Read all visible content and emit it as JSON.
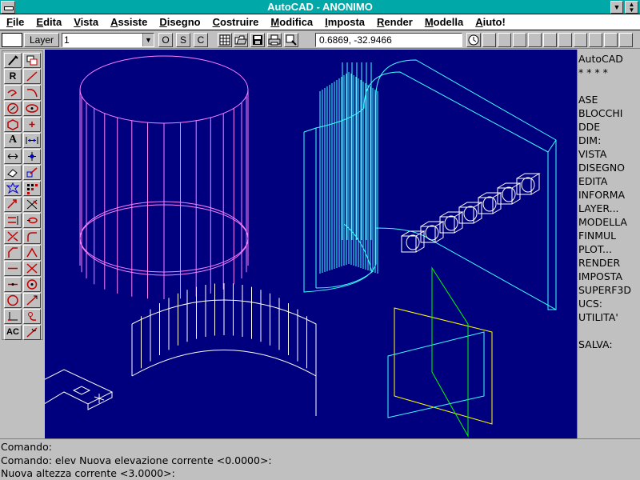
{
  "window": {
    "title": "AutoCAD - ANONIMO",
    "scroll_arrow": "▼"
  },
  "menubar": {
    "items": [
      "File",
      "Edita",
      "Vista",
      "Assiste",
      "Disegno",
      "Costruire",
      "Modifica",
      "Imposta",
      "Render",
      "Modella",
      "Aiuto!"
    ]
  },
  "toolbar": {
    "layer_button": "Layer",
    "layer_value": "1",
    "ortho": "O",
    "snap": "S",
    "tablet": "C",
    "coordinates": "0.6869,  -32.9466",
    "icons": [
      "grid-icon",
      "open-folder-icon",
      "save-icon",
      "print-icon",
      "zoom-window-icon",
      "tool-clock-icon"
    ]
  },
  "palette": {
    "text_tool": "A",
    "regen_tool": "R",
    "text_style_tool": "AC"
  },
  "sidemenu": {
    "items": [
      "AutoCAD",
      "* * * *",
      "",
      "ASE",
      "BLOCCHI",
      "DDE",
      "DIM:",
      "VISTA",
      "DISEGNO",
      "EDITA",
      "INFORMA",
      "LAYER...",
      "MODELLA",
      "FINMUL",
      "PLOT...",
      "RENDER",
      "IMPOSTA",
      "SUPERF3D",
      "UCS:",
      "UTILITA'",
      "",
      "SALVA:"
    ]
  },
  "command": {
    "lines": [
      "Comando:",
      "Comando: elev Nuova elevazione corrente <0.0000>:",
      "Nuova altezza corrente <3.0000>:"
    ]
  },
  "colors": {
    "titlebar": "#00a8a8",
    "drawing_bg": "#00007f",
    "magenta": "#ff80ff",
    "cyan": "#40ffff",
    "white": "#ffffff",
    "yellow": "#ffff00",
    "green": "#00ff00"
  }
}
